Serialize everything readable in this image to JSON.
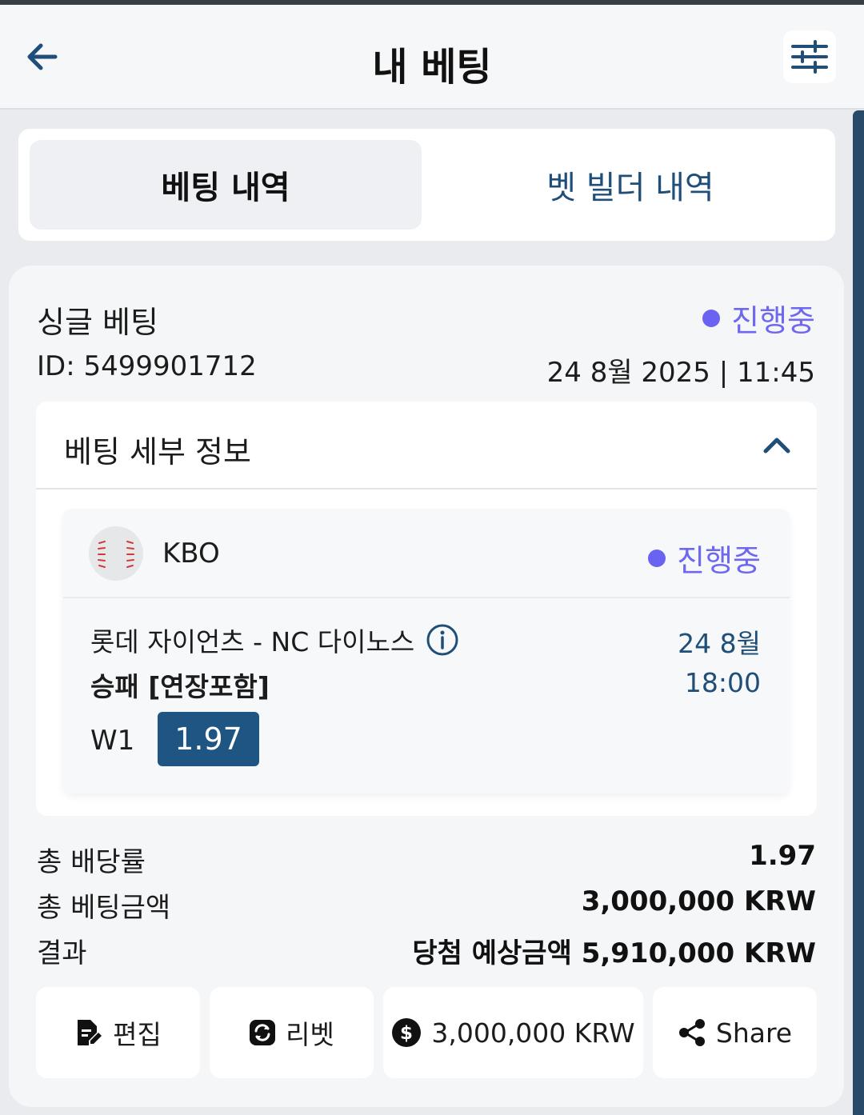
{
  "header": {
    "title": "내 베팅",
    "back_icon": "arrow-left-icon",
    "filter_icon": "sliders-icon"
  },
  "tabs": [
    {
      "label": "베팅 내역",
      "active": true
    },
    {
      "label": "벳 빌더 내역",
      "active": false
    }
  ],
  "bet": {
    "type": "싱글 베팅",
    "status": "진행중",
    "status_color": "#6a63f2",
    "id": "ID: 5499901712",
    "datetime": "24 8월 2025 | 11:45",
    "details": {
      "title": "베팅 세부 정보",
      "event": {
        "league": "KBO",
        "league_icon": "baseball-icon",
        "status": "진행중",
        "match": "롯데 자이언츠 - NC 다이노스",
        "date": "24 8월",
        "time": "18:00",
        "market": "승패 [연장포함]",
        "pick": "W1",
        "odds": "1.97"
      }
    },
    "summary": {
      "total_odds_label": "총 배당률",
      "total_odds": "1.97",
      "total_stake_label": "총 베팅금액",
      "total_stake": "3,000,000 KRW",
      "result_label": "결과",
      "result": "당첨 예상금액 5,910,000 KRW"
    },
    "actions": {
      "edit": "편집",
      "rebet": "리벳",
      "cashout": "3,000,000 KRW",
      "share": "Share"
    }
  },
  "colors": {
    "accent": "#1f5582",
    "link": "#1f4f78",
    "status": "#6a63f2"
  }
}
